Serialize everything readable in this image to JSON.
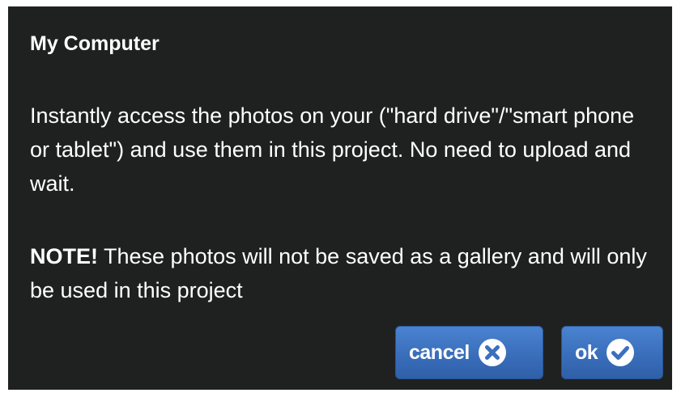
{
  "dialog": {
    "title": "My Computer",
    "body": "Instantly access the photos on your (\"hard drive\"/\"smart phone or tablet\") and use them in this project. No need to upload and wait.",
    "note_label": "NOTE!",
    "note_text": " These photos will not be saved as a gallery and will only be used in this project"
  },
  "buttons": {
    "cancel": {
      "label": "cancel",
      "icon": "close-circle-icon"
    },
    "ok": {
      "label": "ok",
      "icon": "check-circle-icon"
    }
  },
  "colors": {
    "dialog_background": "#1f2121",
    "button_blue": "#3b70bd",
    "text": "#ffffff"
  }
}
